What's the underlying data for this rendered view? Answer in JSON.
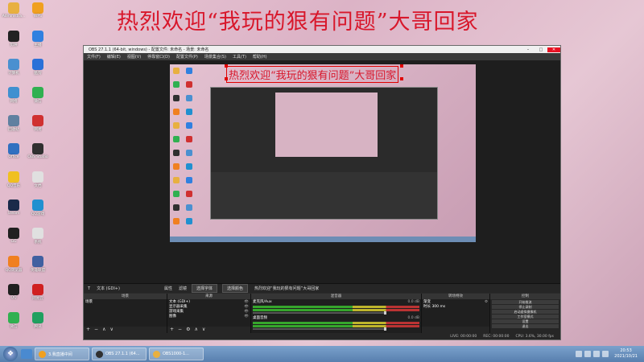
{
  "overlay": {
    "title": "热烈欢迎“我玩的狠有问题”大哥回家"
  },
  "desktop": {
    "icons": [
      {
        "label": "Administra...",
        "color": "#e8b040"
      },
      {
        "label": "WPS",
        "color": "#f0a020"
      },
      {
        "label": "剪映",
        "color": "#222222"
      },
      {
        "label": "主播",
        "color": "#3080e0"
      },
      {
        "label": "计算机",
        "color": "#4a90d0"
      },
      {
        "label": "酷狗",
        "color": "#2a70d8"
      },
      {
        "label": "网络",
        "color": "#4090d0"
      },
      {
        "label": "微信",
        "color": "#30b050"
      },
      {
        "label": "回收站",
        "color": "#6080a0"
      },
      {
        "label": "网易",
        "color": "#d03030"
      },
      {
        "label": "Office",
        "color": "#3070c0"
      },
      {
        "label": "OBS Studio",
        "color": "#303030"
      },
      {
        "label": "QQ音乐",
        "color": "#f0c020"
      },
      {
        "label": "文档",
        "color": "#e0e0e0"
      },
      {
        "label": "Steam",
        "color": "#1a2a4a"
      },
      {
        "label": "QQ游戏",
        "color": "#2090d0"
      },
      {
        "label": "GG",
        "color": "#202020"
      },
      {
        "label": "系统",
        "color": "#e0e0e0"
      },
      {
        "label": "QQ浏览器",
        "color": "#f08020"
      },
      {
        "label": "英雄联盟",
        "color": "#4060a0"
      },
      {
        "label": "QQ",
        "color": "#202020"
      },
      {
        "label": "网易云",
        "color": "#d02020"
      },
      {
        "label": "微信",
        "color": "#30b050"
      },
      {
        "label": "腾讯",
        "color": "#20a060"
      }
    ]
  },
  "obs": {
    "title": "OBS 27.1.1 (64-bit, windows) - 配置文件: 未命名 - 场景: 未命名",
    "menu": [
      "文件(F)",
      "编辑(E)",
      "视图(V)",
      "停靠窗口(D)",
      "配置文件(P)",
      "场景集合(S)",
      "工具(T)",
      "帮助(H)"
    ],
    "canvas_title": "热烈欢迎“我玩的狠有问题”大哥回家",
    "source_bar": {
      "source_name": "文本 (GDI+)",
      "attr1": "属性",
      "attr2": "滤镜",
      "btn1": "选择字体",
      "btn2": "选择颜色",
      "text": "热烈欢迎“我玩的狠有问题”大哥回家"
    },
    "docks": {
      "scenes": {
        "title": "场景",
        "items": [
          "场景"
        ]
      },
      "sources": {
        "title": "来源",
        "items": [
          "文本 (GDI+)",
          "显示器采集",
          "游戏采集",
          "图像"
        ]
      },
      "mixer": {
        "title": "混音器",
        "channels": [
          {
            "name": "麦克风/Aux",
            "db": "0.0 dB"
          },
          {
            "name": "桌面音频",
            "db": "0.0 dB"
          }
        ]
      },
      "transitions": {
        "title": "转场特效",
        "type": "渐变",
        "duration_label": "时长",
        "duration": "300 ms"
      },
      "controls": {
        "title": "控制",
        "buttons": [
          "开始推流",
          "停止录制",
          "启动虚拟摄像机",
          "工作室模式",
          "设置",
          "退出"
        ]
      }
    },
    "status": {
      "live": "LIVE: 00:00:00",
      "rec": "REC: 00:00:00",
      "cpu": "CPU: 3.6%, 30.00 fps"
    }
  },
  "taskbar": {
    "items": [
      {
        "label": "3.我直播中间",
        "color": "#f0a020"
      },
      {
        "label": "OBS 27.1.1 (64...",
        "color": "#303030"
      },
      {
        "label": "OBS1000-1...",
        "color": "#e8b040"
      }
    ],
    "time": "20:53",
    "date": "2021/10/21"
  }
}
